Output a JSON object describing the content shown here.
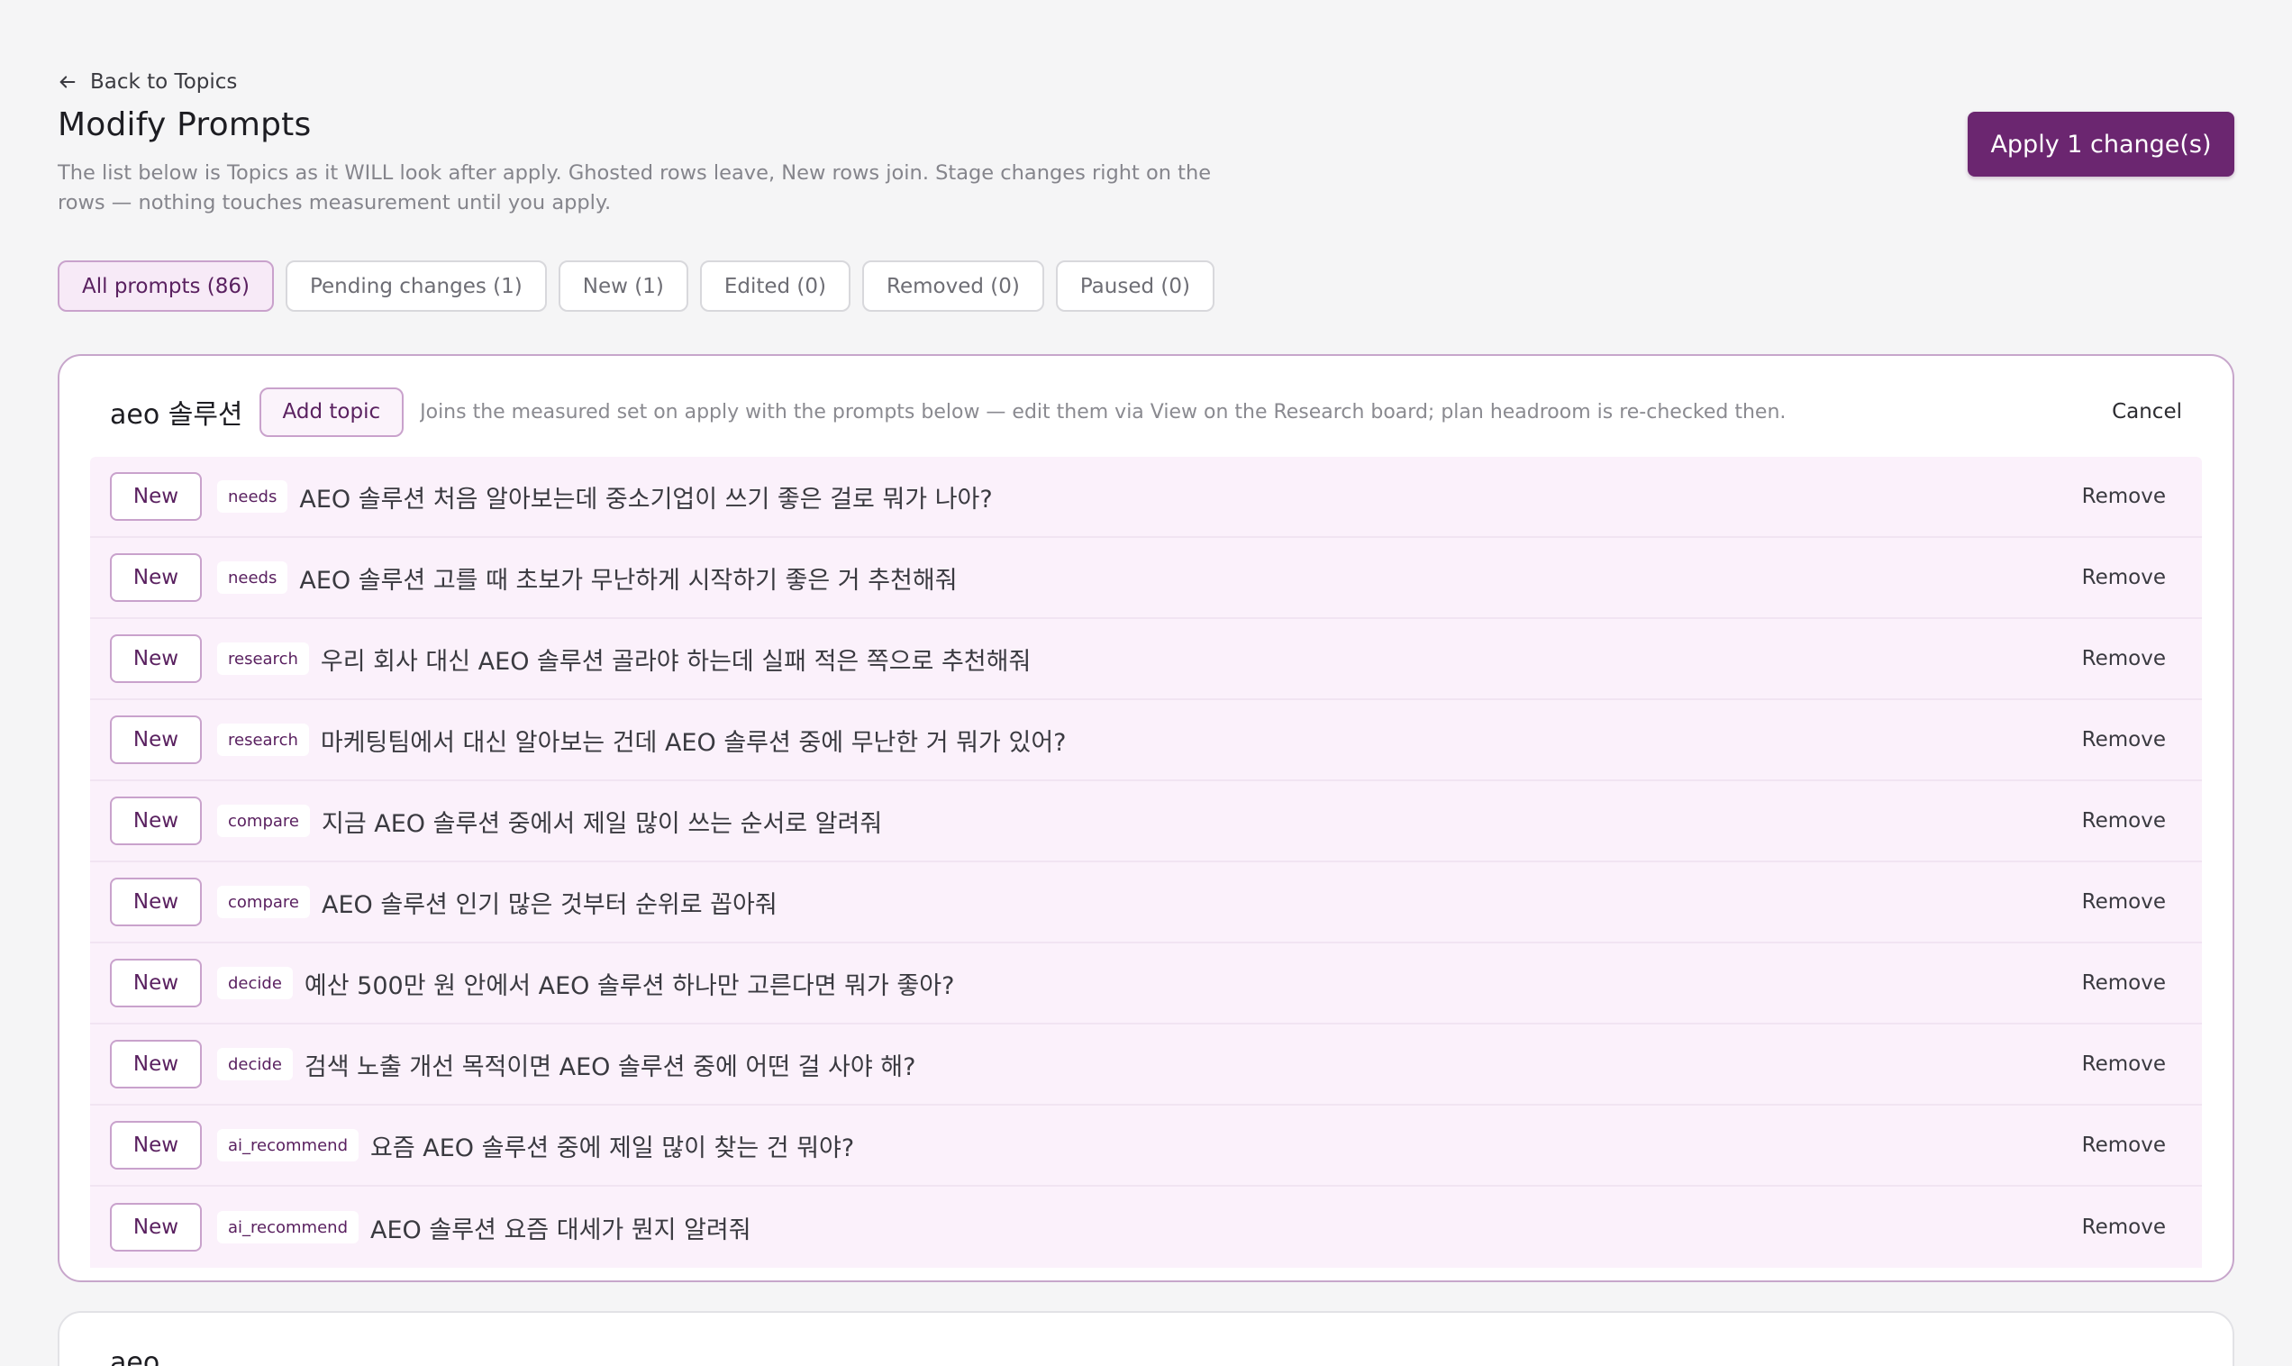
{
  "header": {
    "back_label": "Back to Topics",
    "title": "Modify Prompts",
    "description": "The list below is Topics as it WILL look after apply. Ghosted rows leave, New rows join. Stage changes right on the rows — nothing touches measurement until you apply.",
    "apply_label": "Apply 1 change(s)"
  },
  "filters": [
    {
      "label": "All prompts (86)",
      "active": true
    },
    {
      "label": "Pending changes (1)",
      "active": false
    },
    {
      "label": "New (1)",
      "active": false
    },
    {
      "label": "Edited (0)",
      "active": false
    },
    {
      "label": "Removed (0)",
      "active": false
    },
    {
      "label": "Paused (0)",
      "active": false
    }
  ],
  "topic": {
    "name": "aeo 솔루션",
    "add_label": "Add topic",
    "note": "Joins the measured set on apply with the prompts below — edit them via View on the Research board; plan headroom is re-checked then.",
    "cancel_label": "Cancel",
    "rows": [
      {
        "badge": "New",
        "tag": "needs",
        "text": "AEO 솔루션 처음 알아보는데 중소기업이 쓰기 좋은 걸로 뭐가 나아?",
        "action": "Remove"
      },
      {
        "badge": "New",
        "tag": "needs",
        "text": "AEO 솔루션 고를 때 초보가 무난하게 시작하기 좋은 거 추천해줘",
        "action": "Remove"
      },
      {
        "badge": "New",
        "tag": "research",
        "text": "우리 회사 대신 AEO 솔루션 골라야 하는데 실패 적은 쪽으로 추천해줘",
        "action": "Remove"
      },
      {
        "badge": "New",
        "tag": "research",
        "text": "마케팅팀에서 대신 알아보는 건데 AEO 솔루션 중에 무난한 거 뭐가 있어?",
        "action": "Remove"
      },
      {
        "badge": "New",
        "tag": "compare",
        "text": "지금 AEO 솔루션 중에서 제일 많이 쓰는 순서로 알려줘",
        "action": "Remove"
      },
      {
        "badge": "New",
        "tag": "compare",
        "text": "AEO 솔루션 인기 많은 것부터 순위로 꼽아줘",
        "action": "Remove"
      },
      {
        "badge": "New",
        "tag": "decide",
        "text": "예산 500만 원 안에서 AEO 솔루션 하나만 고른다면 뭐가 좋아?",
        "action": "Remove"
      },
      {
        "badge": "New",
        "tag": "decide",
        "text": "검색 노출 개선 목적이면 AEO 솔루션 중에 어떤 걸 사야 해?",
        "action": "Remove"
      },
      {
        "badge": "New",
        "tag": "ai_recommend",
        "text": "요즘 AEO 솔루션 중에 제일 많이 찾는 건 뭐야?",
        "action": "Remove"
      },
      {
        "badge": "New",
        "tag": "ai_recommend",
        "text": "AEO 솔루션 요즘 대세가 뭔지 알려줘",
        "action": "Remove"
      }
    ]
  },
  "next_topic": {
    "name": "aeo"
  },
  "colors": {
    "brand": "#6b2670",
    "row_bg": "#fbf1fb",
    "card_border": "#c7a6cb"
  },
  "icons": {
    "back": "arrow-left-icon"
  }
}
